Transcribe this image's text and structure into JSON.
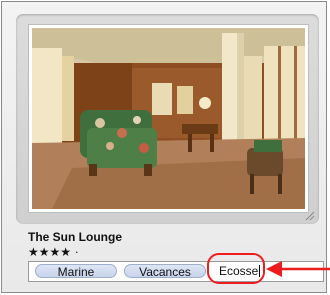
{
  "photo": {
    "caption": "The Sun Lounge",
    "rating_stars": "★★★★",
    "rating_remainder": "·"
  },
  "keywords": {
    "tokens": [
      "Marine",
      "Vacances"
    ],
    "editing_text": "Ecosse"
  },
  "colors": {
    "callout": "#ee1c1c",
    "token_fill": "#c8d4ea"
  },
  "icons": [
    "resize-corner-icon",
    "callout-arrow-icon"
  ]
}
